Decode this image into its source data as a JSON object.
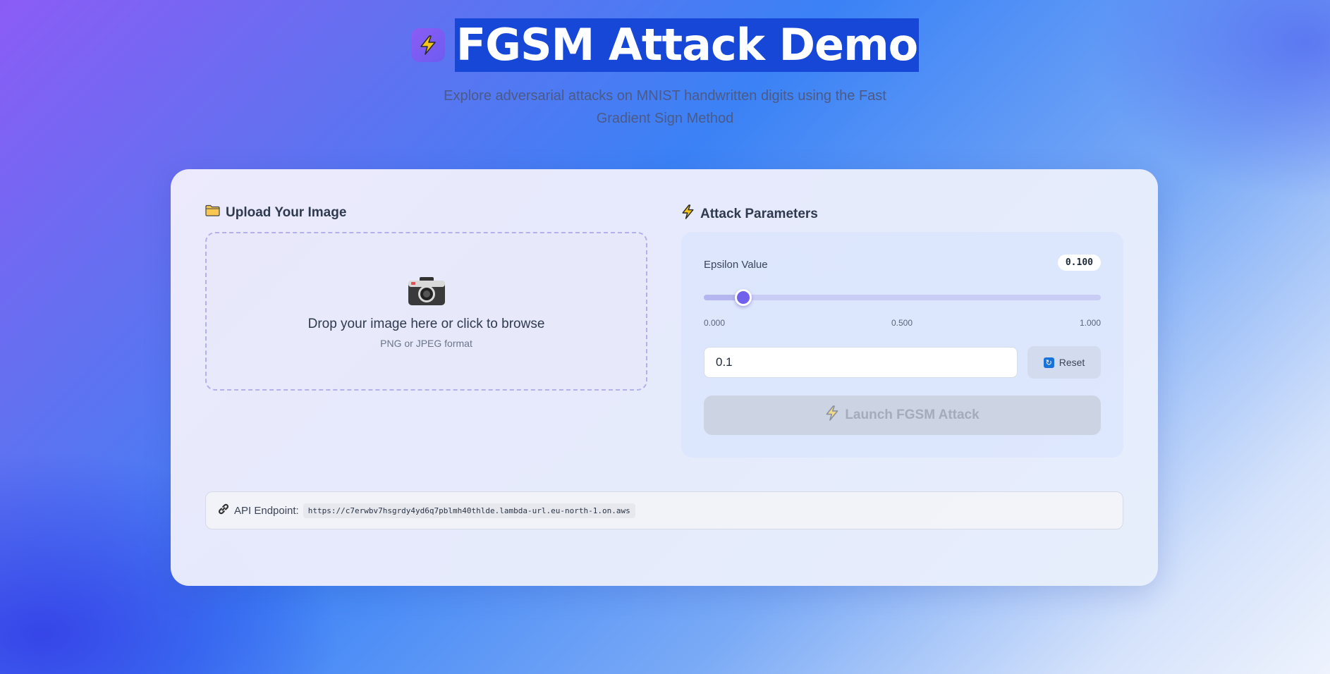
{
  "header": {
    "icon": "lightning-bolt-icon",
    "title": "FGSM Attack Demo",
    "subtitle": "Explore adversarial attacks on MNIST handwritten digits using the Fast Gradient Sign Method"
  },
  "upload": {
    "section_icon": "folder-icon",
    "section_title": "Upload Your Image",
    "dropzone_icon": "camera-icon",
    "dropzone_text": "Drop your image here or click to browse",
    "dropzone_hint": "PNG or JPEG format"
  },
  "params": {
    "section_icon": "lightning-bolt-icon",
    "section_title": "Attack Parameters",
    "epsilon_label": "Epsilon Value",
    "epsilon_display": "0.100",
    "slider": {
      "min": 0,
      "max": 1,
      "value": 0.1
    },
    "ticks": {
      "min": "0.000",
      "mid": "0.500",
      "max": "1.000"
    },
    "input_value": "0.1",
    "reset_label": "Reset",
    "reset_icon": "refresh-icon",
    "launch_label": "Launch FGSM Attack",
    "launch_disabled": true
  },
  "api": {
    "icon": "link-icon",
    "label": "API Endpoint:",
    "url": "https://c7erwbv7hsgrdy4yd6q7pblmh40thlde.lambda-url.eu-north-1.on.aws"
  },
  "colors": {
    "accent": "#7160ec",
    "title_highlight": "#1747d6",
    "bolt": "#f5c518"
  }
}
